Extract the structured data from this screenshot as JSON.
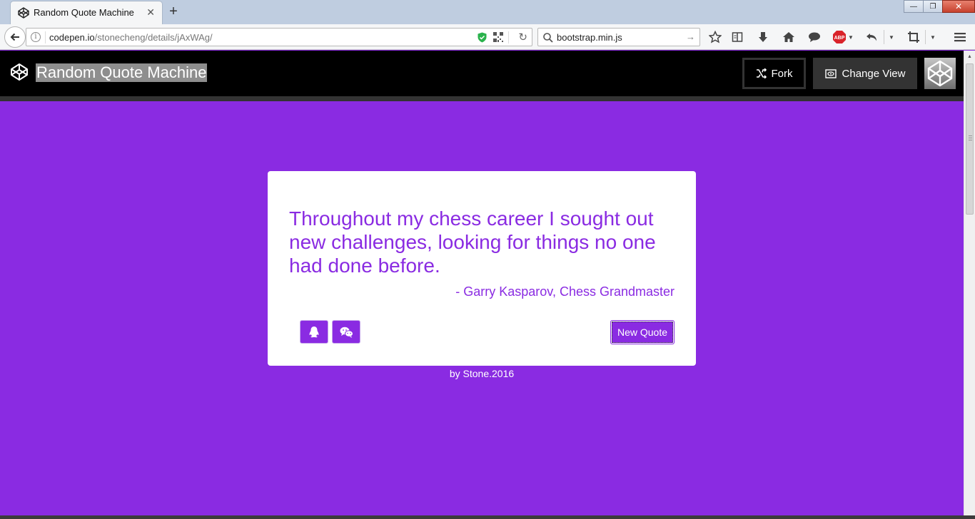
{
  "browser": {
    "tab_title": "Random Quote Machine",
    "tab_close": "✕",
    "new_tab": "+",
    "url_host": "codepen.io",
    "url_path": "/stonecheng/details/jAxWAg/",
    "search_value": "bootstrap.min.js",
    "window_buttons": {
      "minimize": "—",
      "maximize": "❐",
      "close": "✕"
    }
  },
  "codepen": {
    "title": "Random Quote Machine",
    "fork_label": "Fork",
    "change_view_label": "Change View"
  },
  "quote": {
    "text": "Throughout my chess career I sought out new challenges, looking for things no one had done before.",
    "author": "- Garry Kasparov, Chess Grandmaster",
    "new_quote_label": "New Quote",
    "share_icons": [
      "qq-icon",
      "wechat-icon"
    ]
  },
  "footer": {
    "credit": "by Stone.2016"
  },
  "colors": {
    "accent": "#8a2be2",
    "header_bg": "#000000",
    "card_bg": "#ffffff"
  }
}
